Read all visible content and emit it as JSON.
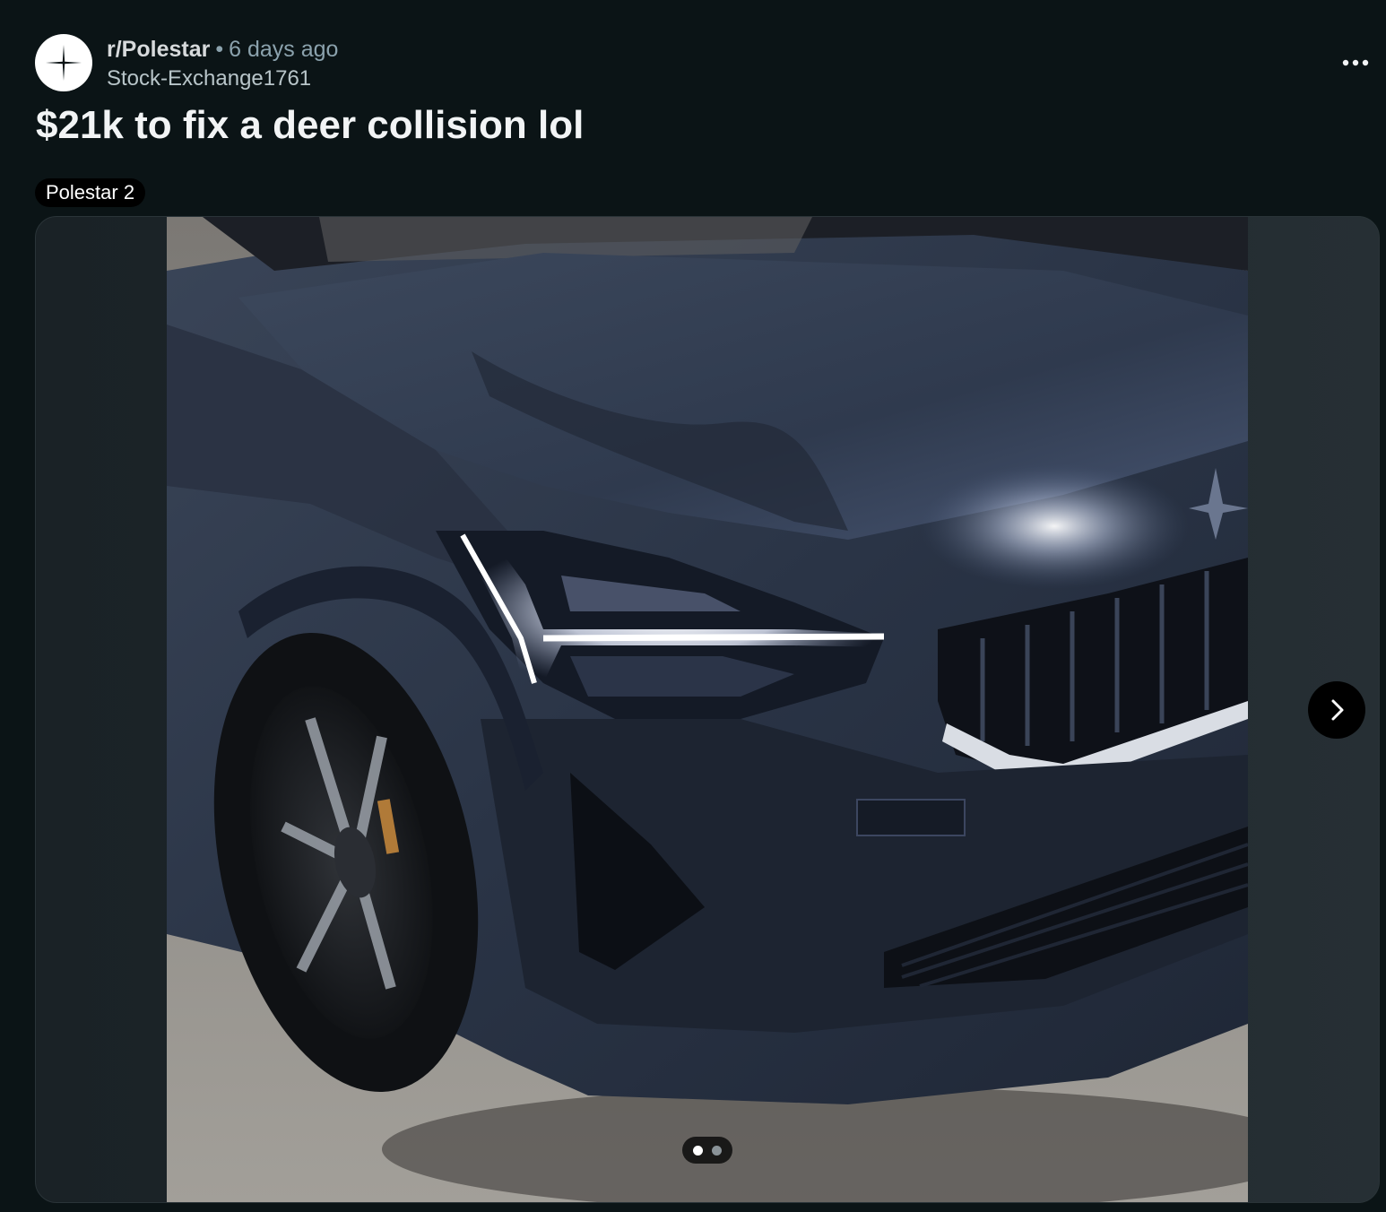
{
  "post": {
    "subreddit": "r/Polestar",
    "separator": "•",
    "time_ago": "6 days ago",
    "author": "Stock-Exchange1761",
    "title": "$21k to fix a deer collision lol",
    "flair": "Polestar 2"
  },
  "icons": {
    "subreddit_avatar": "polestar-logo-icon",
    "more": "more-options-icon",
    "next": "chevron-right-icon"
  },
  "gallery": {
    "image_description": "Dark blue Polestar 2 front corner with headlight on, parked in a garage",
    "total_images": 2,
    "current_index": 1
  },
  "colors": {
    "background": "#0b1416",
    "text_primary": "#f2f4f5",
    "text_secondary": "#8ba2ad",
    "flair_bg": "#000000",
    "car_paint": "#2b3648"
  }
}
